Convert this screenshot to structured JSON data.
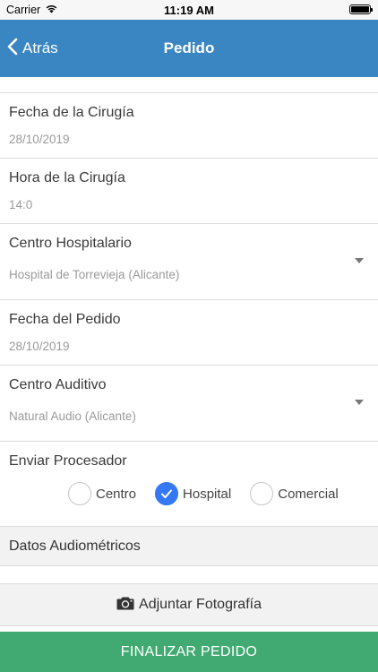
{
  "status_bar": {
    "carrier": "Carrier",
    "time": "11:19 AM"
  },
  "nav": {
    "back_label": "Atrás",
    "title": "Pedido"
  },
  "fields": {
    "surgery_date": {
      "label": "Fecha de la Cirugía",
      "value": "28/10/2019"
    },
    "surgery_time": {
      "label": "Hora de la Cirugía",
      "value": "14:0"
    },
    "hospital_center": {
      "label": "Centro Hospitalario",
      "value": "Hospital de Torrevieja (Alicante)"
    },
    "order_date": {
      "label": "Fecha del Pedido",
      "value": "28/10/2019"
    },
    "hearing_center": {
      "label": "Centro Auditivo",
      "value": "Natural Audio (Alicante)"
    }
  },
  "send_processor": {
    "label": "Enviar Procesador",
    "options": [
      "Centro",
      "Hospital",
      "Comercial"
    ],
    "selected": "Hospital"
  },
  "audiometric_header": "Datos Audiométricos",
  "attach_photo_label": "Adjuntar Fotografía",
  "finalize_label": "FINALIZAR PEDIDO",
  "colors": {
    "nav_bar": "#3a86c3",
    "finalize_button": "#41aa72",
    "radio_checked": "#3478f6"
  }
}
